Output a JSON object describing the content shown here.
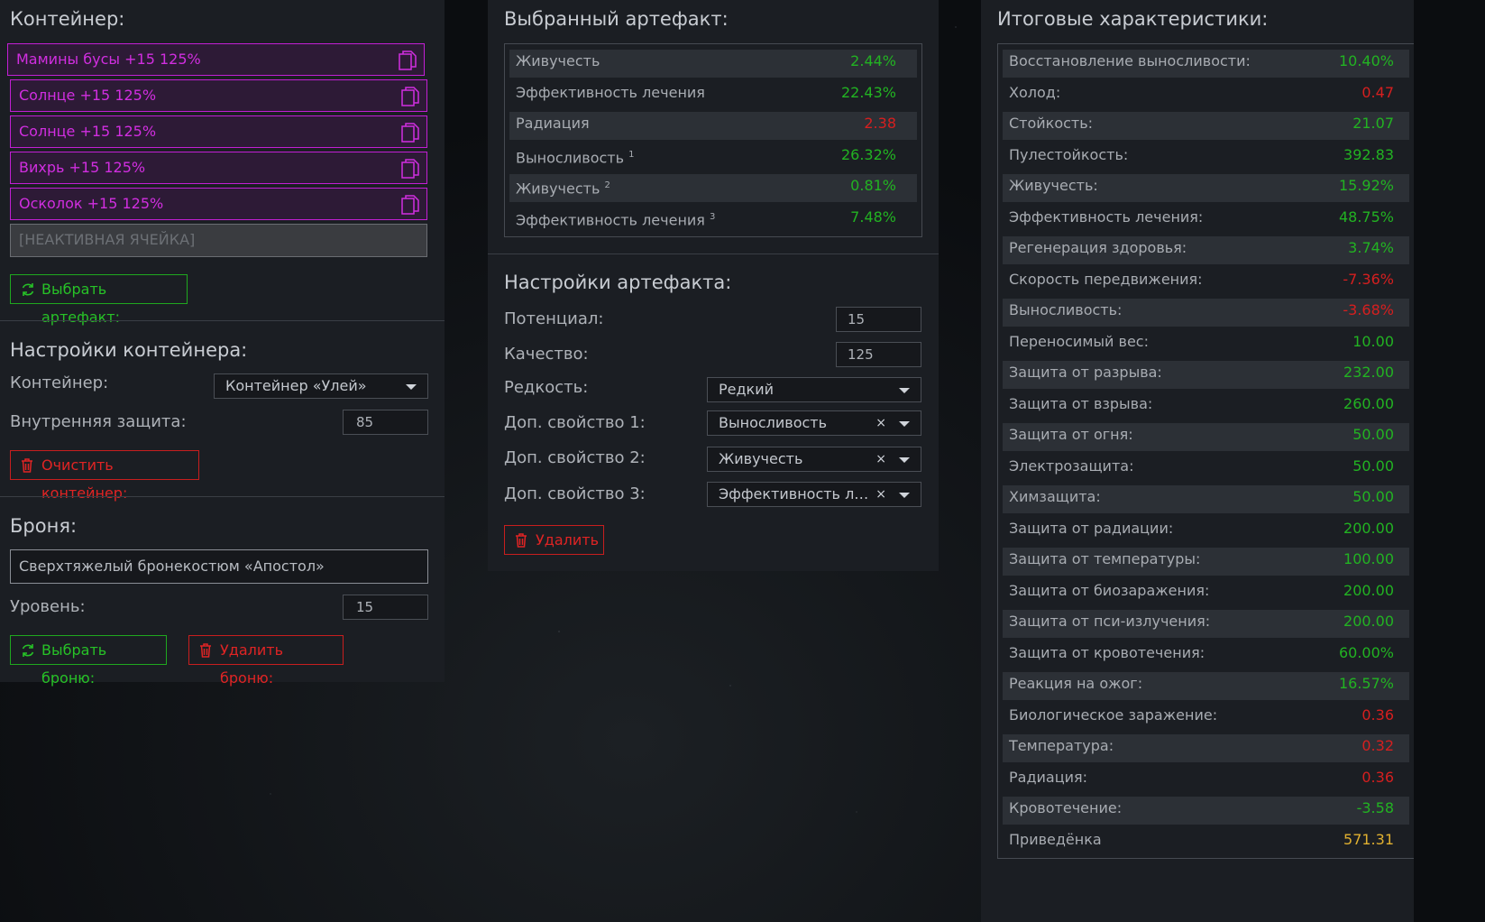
{
  "container": {
    "title": "Контейнер:",
    "slots": [
      {
        "label": "Мамины бусы +15 125%"
      },
      {
        "label": "Солнце +15 125%"
      },
      {
        "label": "Солнце +15 125%"
      },
      {
        "label": "Вихрь +15 125%"
      },
      {
        "label": "Осколок +15 125%"
      }
    ],
    "inactive_slot": "[НЕАКТИВНАЯ ЯЧЕЙКА]",
    "select_artifact_button": "Выбрать артефакт:"
  },
  "container_settings": {
    "title": "Настройки контейнера:",
    "container_label": "Контейнер:",
    "container_value": "Контейнер «Улей»",
    "internal_protection_label": "Внутренняя защита:",
    "internal_protection_value": "85",
    "clear_button": "Очистить контейнер:"
  },
  "armor": {
    "title": "Броня:",
    "armor_value": "Сверхтяжелый бронекостюм «Апостол»",
    "level_label": "Уровень:",
    "level_value": "15",
    "select_button": "Выбрать броню:",
    "delete_button": "Удалить броню:"
  },
  "selected_artifact": {
    "title": "Выбранный артефакт:",
    "stats": [
      {
        "name": "Живучесть",
        "sup": "",
        "value": "2.44%",
        "color": "green"
      },
      {
        "name": "Эффективность лечения",
        "sup": "",
        "value": "22.43%",
        "color": "green"
      },
      {
        "name": "Радиация",
        "sup": "",
        "value": "2.38",
        "color": "red"
      },
      {
        "name": "Выносливость",
        "sup": "1",
        "value": "26.32%",
        "color": "green"
      },
      {
        "name": "Живучесть",
        "sup": "2",
        "value": "0.81%",
        "color": "green"
      },
      {
        "name": "Эффективность лечения",
        "sup": "3",
        "value": "7.48%",
        "color": "green"
      }
    ]
  },
  "artifact_settings": {
    "title": "Настройки артефакта:",
    "potential_label": "Потенциал:",
    "potential_value": "15",
    "quality_label": "Качество:",
    "quality_value": "125",
    "rarity_label": "Редкость:",
    "rarity_value": "Редкий",
    "prop1_label": "Доп. свойство 1:",
    "prop1_value": "Выносливость",
    "prop2_label": "Доп. свойство 2:",
    "prop2_value": "Живучесть",
    "prop3_label": "Доп. свойство 3:",
    "prop3_value": "Эффективность лечения",
    "clear_symbol": "×",
    "delete_button": "Удалить"
  },
  "totals": {
    "title": "Итоговые характеристики:",
    "stats": [
      {
        "name": "Восстановление выносливости:",
        "value": "10.40%",
        "color": "green"
      },
      {
        "name": "Холод:",
        "value": "0.47",
        "color": "red"
      },
      {
        "name": "Стойкость:",
        "value": "21.07",
        "color": "green"
      },
      {
        "name": "Пулестойкость:",
        "value": "392.83",
        "color": "green"
      },
      {
        "name": "Живучесть:",
        "value": "15.92%",
        "color": "green"
      },
      {
        "name": "Эффективность лечения:",
        "value": "48.75%",
        "color": "green"
      },
      {
        "name": "Регенерация здоровья:",
        "value": "3.74%",
        "color": "green"
      },
      {
        "name": "Скорость передвижения:",
        "value": "-7.36%",
        "color": "red"
      },
      {
        "name": "Выносливость:",
        "value": "-3.68%",
        "color": "red"
      },
      {
        "name": "Переносимый вес:",
        "value": "10.00",
        "color": "green"
      },
      {
        "name": "Защита от разрыва:",
        "value": "232.00",
        "color": "green"
      },
      {
        "name": "Защита от взрыва:",
        "value": "260.00",
        "color": "green"
      },
      {
        "name": "Защита от огня:",
        "value": "50.00",
        "color": "green"
      },
      {
        "name": "Электрозащита:",
        "value": "50.00",
        "color": "green"
      },
      {
        "name": "Химзащита:",
        "value": "50.00",
        "color": "green"
      },
      {
        "name": "Защита от радиации:",
        "value": "200.00",
        "color": "green"
      },
      {
        "name": "Защита от температуры:",
        "value": "100.00",
        "color": "green"
      },
      {
        "name": "Защита от биозаражения:",
        "value": "200.00",
        "color": "green"
      },
      {
        "name": "Защита от пси-излучения:",
        "value": "200.00",
        "color": "green"
      },
      {
        "name": "Защита от кровотечения:",
        "value": "60.00%",
        "color": "green"
      },
      {
        "name": "Реакция на ожог:",
        "value": "16.57%",
        "color": "green"
      },
      {
        "name": "Биологическое заражение:",
        "value": "0.36",
        "color": "red"
      },
      {
        "name": "Температура:",
        "value": "0.32",
        "color": "red"
      },
      {
        "name": "Радиация:",
        "value": "0.36",
        "color": "red"
      },
      {
        "name": "Кровотечение:",
        "value": "-3.58",
        "color": "green"
      },
      {
        "name": "Приведёнка",
        "value": "571.31",
        "color": "gold"
      }
    ]
  },
  "colors": {
    "green": "#22b322",
    "red": "#d61f1f",
    "gold": "#e0b030",
    "accent": "#c21fd4"
  }
}
